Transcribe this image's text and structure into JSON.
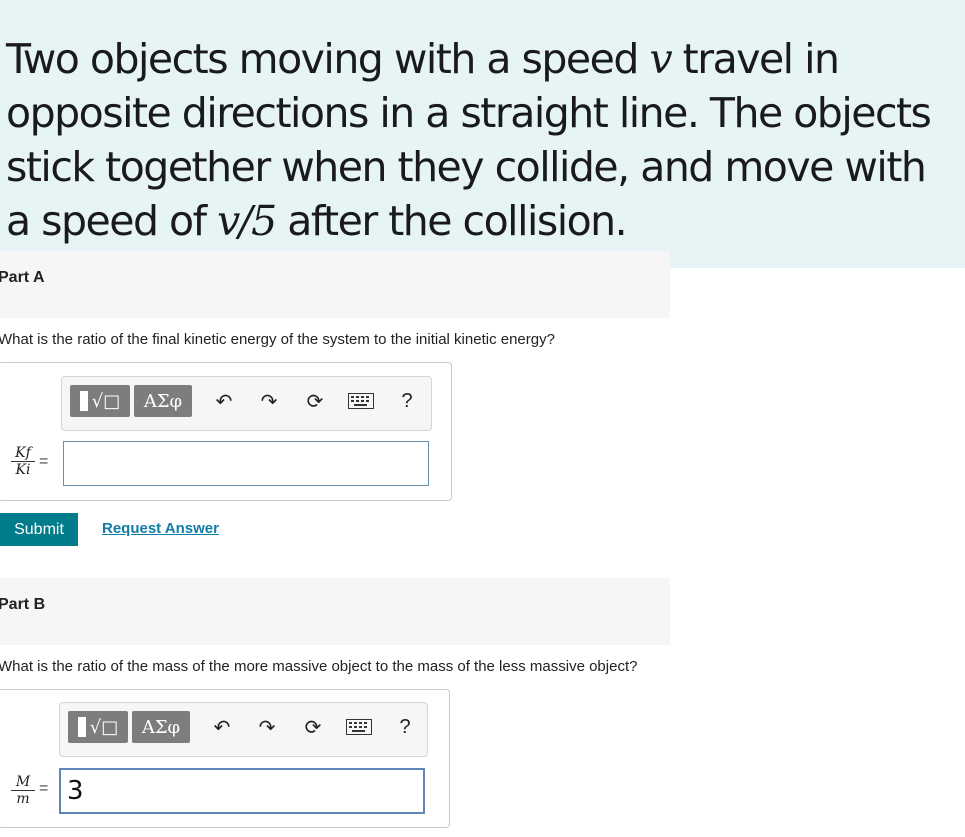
{
  "intro": {
    "line1_a": "Two objects moving with a speed ",
    "var_v": "v",
    "line1_b": " travel in opposite directions in a straight line. The objects stick together when they collide, and move with a speed of ",
    "speed_fraction": "v/5",
    "line1_c": " after the collision."
  },
  "part_a": {
    "heading": "Part A",
    "question": "What is the ratio of the final kinetic energy of the system to the initial kinetic energy?",
    "lhs_numerator": "Kf",
    "lhs_denominator": "Ki",
    "equals": "=",
    "input_value": "",
    "submit_label": "Submit",
    "request_label": "Request Answer"
  },
  "part_b": {
    "heading": "Part B",
    "question": "What is the ratio of the mass of the more massive object to the mass of the less massive object?",
    "lhs_numerator": "M",
    "lhs_denominator": "m",
    "equals": "=",
    "input_value": "3"
  },
  "toolbar": {
    "templates_label": "√□",
    "greek_label": "ΑΣφ",
    "help_label": "?",
    "icons": [
      "templates-icon",
      "greek-symbols-icon",
      "undo-icon",
      "redo-icon",
      "reset-icon",
      "keyboard-icon",
      "help-icon"
    ]
  },
  "colors": {
    "intro_bg": "#e6f4f6",
    "submit_bg": "#007c8b",
    "link": "#117ca8",
    "toolbar_button": "#7d7d7d"
  }
}
